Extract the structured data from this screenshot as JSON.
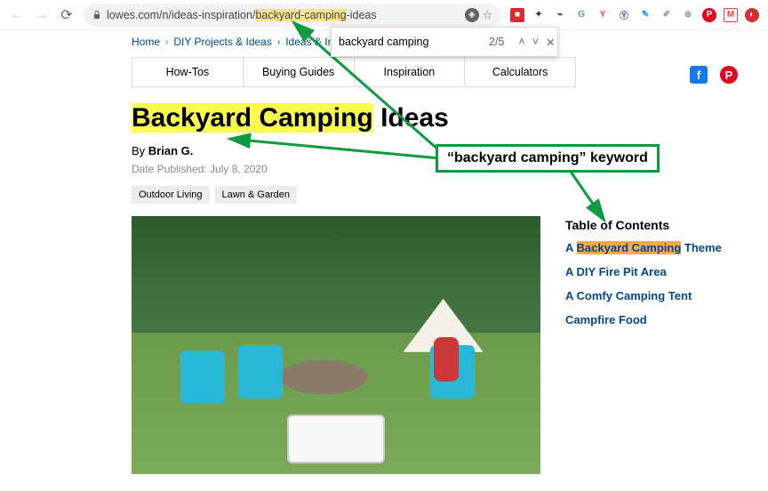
{
  "browser": {
    "url_pre": "lowes.com/n/ideas-inspiration/",
    "url_hl": "backyard-camping",
    "url_post": "-ideas"
  },
  "find": {
    "query": "backyard camping",
    "count": "2/5"
  },
  "breadcrumb": [
    "Home",
    "DIY Projects & Ideas",
    "Ideas & In"
  ],
  "tabs": [
    "How-Tos",
    "Buying Guides",
    "Inspiration",
    "Calculators"
  ],
  "title": {
    "hl": "Backyard Camping",
    "rest": " Ideas"
  },
  "byline": {
    "by": "By ",
    "author": "Brian G."
  },
  "date": "Date Published: July 8, 2020",
  "tags": [
    "Outdoor Living",
    "Lawn & Garden"
  ],
  "toc": {
    "heading": "Table of Contents",
    "items": [
      {
        "pre": "A ",
        "hl": "Backyard Camping",
        "post": " Theme"
      },
      {
        "pre": "A DIY Fire Pit Area",
        "hl": "",
        "post": ""
      },
      {
        "pre": "A Comfy Camping Tent",
        "hl": "",
        "post": ""
      },
      {
        "pre": "Campfire Food",
        "hl": "",
        "post": ""
      }
    ]
  },
  "callout": "“backyard camping” keyword",
  "ext_colors": [
    "#d32f2f",
    "#333",
    "#333",
    "#4caf50",
    "#ffc107",
    "#673ab7",
    "#2196f3",
    "#666",
    "#666",
    "#e60023",
    "#ea4335",
    "#d32f2f"
  ]
}
